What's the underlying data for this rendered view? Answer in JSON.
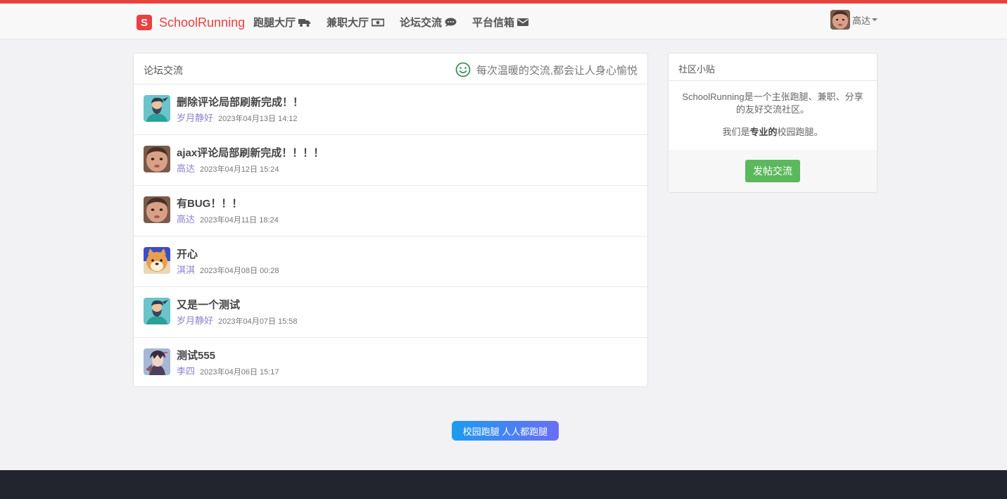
{
  "colors": {
    "accent": "#e8413e",
    "author_link": "#8d7fd0",
    "success_button": "#5cb85c",
    "footer": "#23252e"
  },
  "brand": {
    "logo_letter": "S",
    "name": "SchoolRunning"
  },
  "nav": [
    {
      "label": "跑腿大厅",
      "icon": "truck-icon"
    },
    {
      "label": "兼职大厅",
      "icon": "money-icon"
    },
    {
      "label": "论坛交流",
      "icon": "comments-icon"
    },
    {
      "label": "平台信箱",
      "icon": "envelope-icon"
    }
  ],
  "user": {
    "name": "高达"
  },
  "forum": {
    "title": "论坛交流",
    "tagline": "每次温暖的交流,都会让人身心愉悦",
    "posts": [
      {
        "title": "删除评论局部刷新完成！！",
        "author": "岁月静好",
        "time": "2023年04月13日 14:12",
        "avatar": "bearded-man-avatar"
      },
      {
        "title": "ajax评论局部刷新完成！！！！",
        "author": "高达",
        "time": "2023年04月12日 15:24",
        "avatar": "child-face-avatar"
      },
      {
        "title": "有BUG！！！",
        "author": "高达",
        "time": "2023年04月11日 18:24",
        "avatar": "child-face-avatar"
      },
      {
        "title": "开心",
        "author": "淇淇",
        "time": "2023年04月08日 00:28",
        "avatar": "shiba-dog-avatar"
      },
      {
        "title": "又是一个测试",
        "author": "岁月静好",
        "time": "2023年04月07日 15:58",
        "avatar": "bearded-man-avatar"
      },
      {
        "title": "测试555",
        "author": "李四",
        "time": "2023年04月06日 15:17",
        "avatar": "anime-character-avatar"
      }
    ]
  },
  "sidebar": {
    "title": "社区小贴",
    "intro": "SchoolRunning是一个主张跑腿、兼职、分享的友好交流社区。",
    "line_prefix": "我们是",
    "line_bold": "专业的",
    "line_suffix": "校园跑腿。",
    "button_label": "发帖交流"
  },
  "slogan": "校园跑腿 人人都跑腿"
}
